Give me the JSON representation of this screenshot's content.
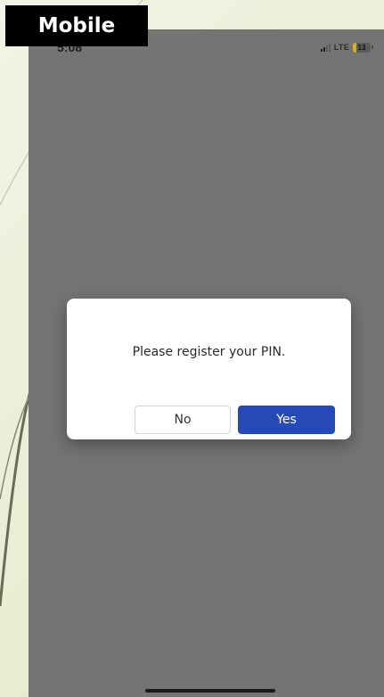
{
  "slide": {
    "label": "Mobile"
  },
  "status_bar": {
    "time": "5:08",
    "network": "LTE",
    "battery": "13",
    "icons": [
      "signal-icon",
      "battery-icon"
    ]
  },
  "dialog": {
    "message": "Please register your PIN.",
    "no_label": "No",
    "yes_label": "Yes"
  },
  "colors": {
    "overlay": "#747474",
    "primary_button": "#2649b8",
    "battery_low": "#d9b021"
  }
}
